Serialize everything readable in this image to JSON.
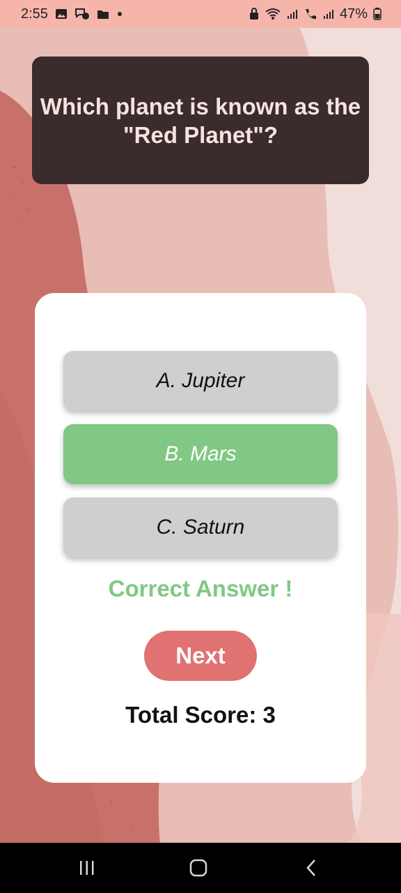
{
  "status_bar": {
    "time": "2:55",
    "battery": "47%",
    "icons": [
      "gallery-icon",
      "messenger-icon",
      "folder-icon",
      "dot-icon",
      "lock-icon",
      "wifi-icon",
      "signal-icon",
      "call-icon",
      "signal-icon",
      "battery-icon"
    ]
  },
  "quiz": {
    "question": "Which planet is known as the \"Red Planet\"?",
    "options": [
      {
        "label": "A. Jupiter",
        "state": "default"
      },
      {
        "label": "B. Mars",
        "state": "correct"
      },
      {
        "label": "C. Saturn",
        "state": "default"
      }
    ],
    "feedback": "Correct Answer !",
    "next_label": "Next",
    "score_text": "Total Score: 3"
  },
  "nav_bar": {
    "icons": [
      "recent-apps-icon",
      "home-icon",
      "back-icon"
    ]
  },
  "colors": {
    "status_bar_bg": "#f6b5ab",
    "question_bg": "#3a2c2c",
    "correct_green": "#80c883",
    "option_grey": "#cfcfcf",
    "next_button": "#e07272"
  }
}
